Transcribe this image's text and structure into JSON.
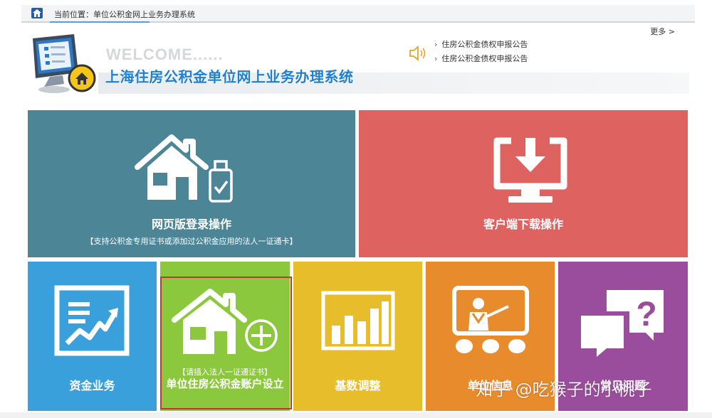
{
  "breadcrumb": {
    "text": "当前位置：单位公积金网上业务办理系统"
  },
  "header": {
    "welcome": "WELCOME......",
    "title": "上海住房公积金单位网上业务办理系统",
    "more": "更多 >",
    "notices": [
      {
        "arrow": "›",
        "text": "住房公积金债权申报公告"
      },
      {
        "arrow": "›",
        "text": "住房公积金债权申报公告"
      }
    ]
  },
  "tiles": {
    "web_login": {
      "label": "网页版登录操作",
      "sub": "【支持公积金专用证书或添加过公积金应用的法人一证通卡】",
      "color": "#4b8596"
    },
    "client_download": {
      "label": "客户端下载操作",
      "color": "#de6260"
    },
    "fund": {
      "label": "资金业务",
      "color": "#3aa0dc"
    },
    "account": {
      "label": "单位住房公积金账户设立",
      "sub": "【请插入法人一证通证书】",
      "color": "#8cc83e"
    },
    "base_adjust": {
      "label": "基数调整",
      "color": "#e8bd2c"
    },
    "unit_info": {
      "label": "单位信息",
      "color": "#e88b2d"
    },
    "faq": {
      "label": "常见问题",
      "color": "#9a4d9c"
    }
  },
  "watermark": "知乎 @吃猴子的小桃子",
  "icons": {
    "home": "home-icon",
    "monitor": "monitor-checklist-icon",
    "speaker": "speaker-icon",
    "house_usb": "house-usb-icon",
    "download_monitor": "download-monitor-icon",
    "chart": "chart-board-icon",
    "house_plus": "house-plus-icon",
    "bars": "bar-chart-icon",
    "teacher": "teacher-board-icon",
    "question": "question-bubble-icon"
  }
}
